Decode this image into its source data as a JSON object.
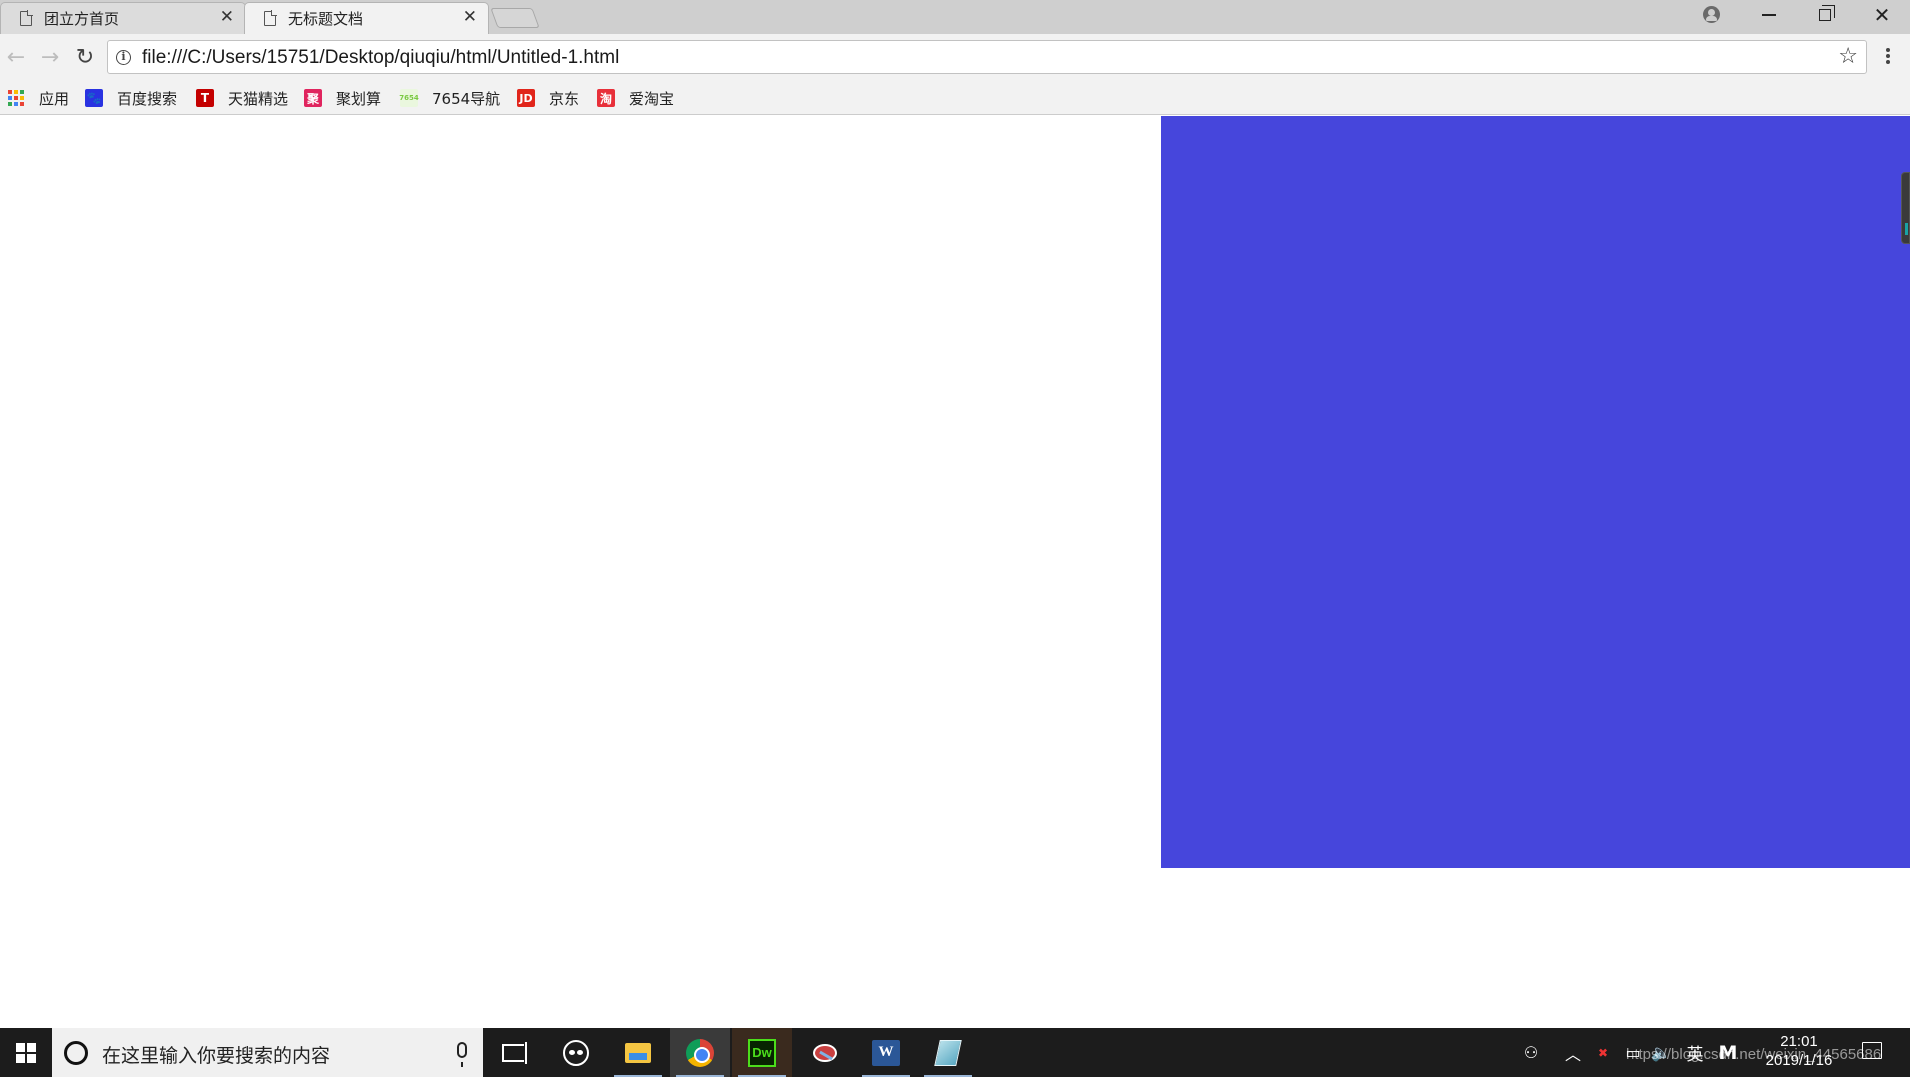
{
  "browser": {
    "tabs": [
      {
        "label": "团立方首页",
        "active": false
      },
      {
        "label": "无标题文档",
        "active": true
      }
    ],
    "address": {
      "url": "file:///C:/Users/15751/Desktop/qiuqiu/html/Untitled-1.html"
    },
    "bookmarks": [
      {
        "label": "应用",
        "icon": "apps-grid-icon"
      },
      {
        "label": "百度搜索",
        "icon": "baidu-paw-icon",
        "icon_text": "",
        "color": "#2932e1"
      },
      {
        "label": "天猫精选",
        "icon": "tmall-icon",
        "icon_text": "T",
        "color": "#c40000"
      },
      {
        "label": "聚划算",
        "icon": "juhuasuan-icon",
        "icon_text": "聚",
        "color": "#e0245e"
      },
      {
        "label": "7654导航",
        "icon": "7654-icon",
        "icon_text": "7654",
        "color": "#7ac943"
      },
      {
        "label": "京东",
        "icon": "jd-icon",
        "icon_text": "JD",
        "color": "#e1251b"
      },
      {
        "label": "爱淘宝",
        "icon": "aitaobao-icon",
        "icon_text": "淘",
        "color": "#e8303a"
      }
    ]
  },
  "page": {
    "background": "#ffffff",
    "box_color": "#4646dc"
  },
  "taskbar": {
    "search_placeholder": "在这里输入你要搜索的内容",
    "ime_label": "英",
    "ime_mode": "M",
    "time": "21:01",
    "date": "2019/1/16",
    "watermark": "https://blog.csdn.net/weixin_44565686"
  }
}
